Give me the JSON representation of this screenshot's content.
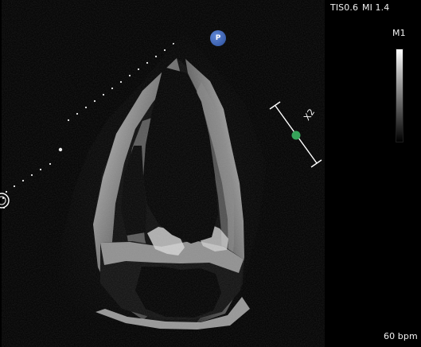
{
  "overlay": {
    "tis": "TIS0.6",
    "mi": "MI 1.4",
    "mode_label": "M1",
    "heart_rate": "60 bpm",
    "probe_marker": "P",
    "zoom_label": "X2"
  },
  "colors": {
    "background": "#000000",
    "overlay_text": "#f2f2f2",
    "probe_marker": "#3e63b0",
    "measurement_dot": "#36a35a"
  },
  "icons": {
    "probe_marker": "orientation-marker-icon",
    "measurement_cursor": "depth-caliper-icon"
  }
}
